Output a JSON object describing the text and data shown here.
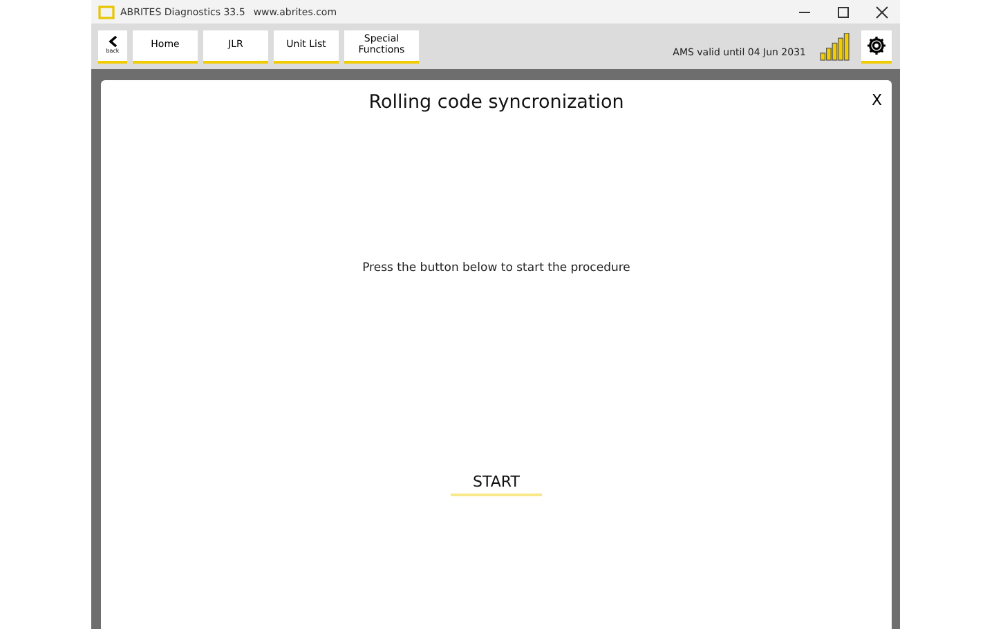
{
  "window": {
    "title": "ABRITES Diagnostics 33.5",
    "url": "www.abrites.com"
  },
  "toolbar": {
    "back_label": "back",
    "tabs": [
      {
        "label": "Home"
      },
      {
        "label": "JLR"
      },
      {
        "label": "Unit List"
      },
      {
        "label": "Special Functions"
      }
    ],
    "license": "AMS valid until 04 Jun 2031"
  },
  "dialog": {
    "title": "Rolling code syncronization",
    "close": "X",
    "message": "Press the button below to start the procedure",
    "button": "START"
  }
}
